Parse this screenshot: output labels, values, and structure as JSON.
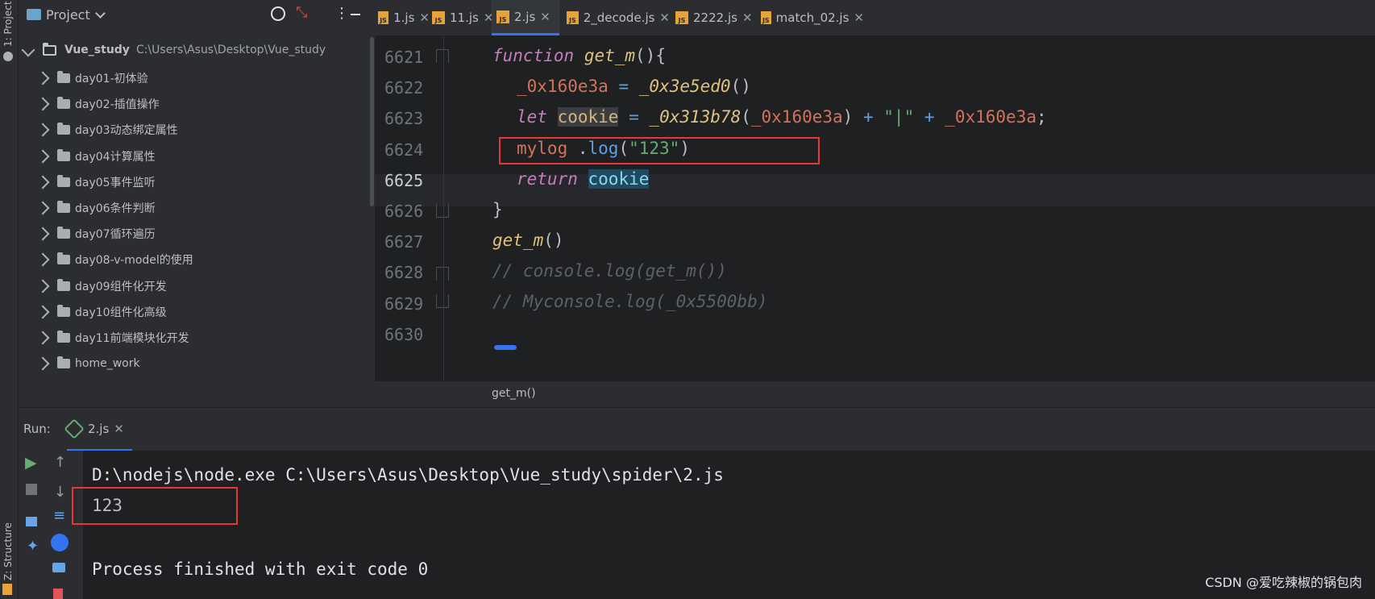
{
  "left_strip": {
    "project_label": "1: Project",
    "structure_label": "Z: Structure"
  },
  "project": {
    "title": "Project",
    "root": {
      "name": "Vue_study",
      "path": "C:\\Users\\Asus\\Desktop\\Vue_study"
    },
    "items": [
      "day01-初体验",
      "day02-插值操作",
      "day03动态绑定属性",
      "day04计算属性",
      "day05事件监听",
      "day06条件判断",
      "day07循环遍历",
      "day08-v-model的使用",
      "day09组件化开发",
      "day10组件化高级",
      "day11前端模块化开发",
      "home_work"
    ]
  },
  "tabs": [
    {
      "label": "1.js",
      "active": false
    },
    {
      "label": "11.js",
      "active": false
    },
    {
      "label": "2.js",
      "active": true
    },
    {
      "label": "2_decode.js",
      "active": false
    },
    {
      "label": "2222.js",
      "active": false
    },
    {
      "label": "match_02.js",
      "active": false
    }
  ],
  "editor": {
    "line_numbers": [
      "6621",
      "6622",
      "6623",
      "6624",
      "6625",
      "6626",
      "6627",
      "6628",
      "6629",
      "6630"
    ],
    "breadcrumb": "get_m()"
  },
  "run": {
    "label": "Run:",
    "tab_label": "2.js",
    "console": {
      "command": "D:\\nodejs\\node.exe C:\\Users\\Asus\\Desktop\\Vue_study\\spider\\2.js",
      "output": "123",
      "finish": "Process finished with exit code 0"
    }
  },
  "watermark": "CSDN @爱吃辣椒的锅包肉",
  "colors": {
    "accent": "#3574f0",
    "highlight_box": "#e53935",
    "js_badge": "#e8a23a"
  }
}
